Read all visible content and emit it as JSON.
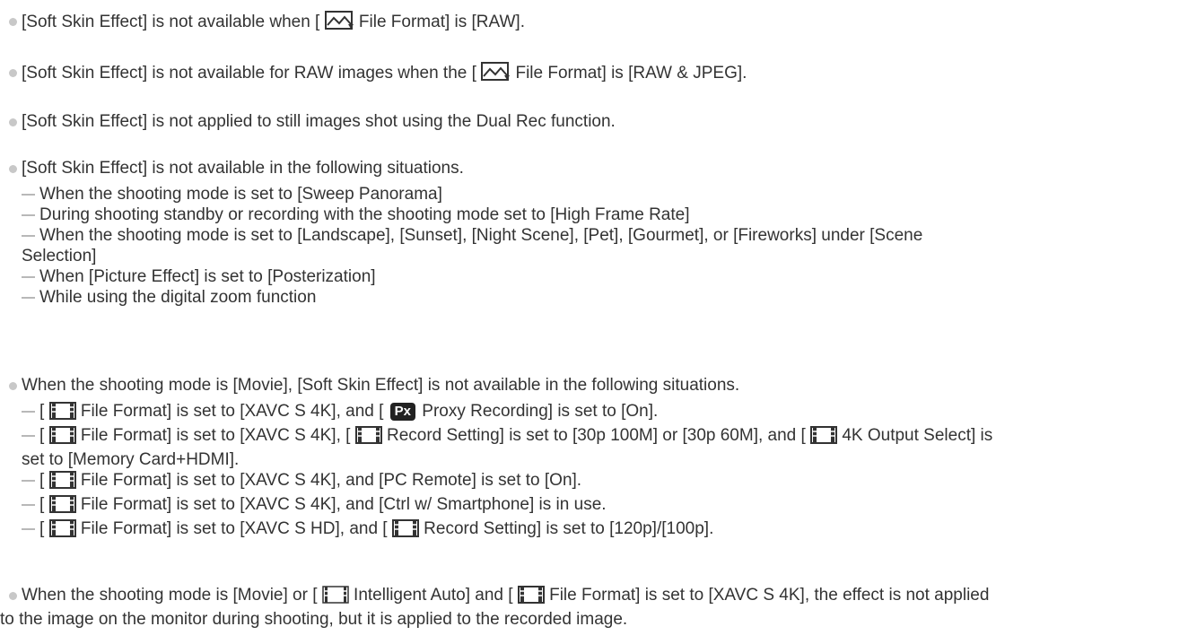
{
  "bullets": {
    "b1": {
      "pre": "[Soft Skin Effect] is not available when [ ",
      "post": " File Format] is [RAW]."
    },
    "b2": {
      "pre": "[Soft Skin Effect] is not available for RAW images when the [ ",
      "post": " File Format] is [RAW & JPEG]."
    },
    "b3": {
      "text": "[Soft Skin Effect] is not applied to still images shot using the Dual Rec function."
    },
    "b4": {
      "text": "[Soft Skin Effect] is not available in the following situations.",
      "items": [
        "When the shooting mode is set to [Sweep Panorama]",
        "During shooting standby or recording with the shooting mode set to [High Frame Rate]",
        "When the shooting mode is set to [Landscape], [Sunset], [Night Scene], [Pet], [Gourmet], or [Fireworks] under [Scene",
        "Selection]",
        "When [Picture Effect] is set to [Posterization]",
        "While using the digital zoom function"
      ]
    },
    "b5": {
      "text": "When the shooting mode is [Movie], [Soft Skin Effect] is not available in the following situations.",
      "px_label": "Px",
      "i1": {
        "a": "[ ",
        "b": " File Format] is set to [XAVC S 4K], and [ ",
        "c": " Proxy Recording] is set to [On]."
      },
      "i2": {
        "a": "[ ",
        "b": " File Format] is set to [XAVC S 4K], [ ",
        "c": " Record Setting] is set to [30p 100M] or [30p 60M], and [ ",
        "d": " 4K Output Select] is",
        "e": "set to [Memory Card+HDMI]."
      },
      "i3": {
        "a": "[ ",
        "b": " File Format] is set to [XAVC S 4K], and [PC Remote] is set to [On]."
      },
      "i4": {
        "a": "[ ",
        "b": " File Format] is set to [XAVC S 4K], and [Ctrl w/ Smartphone] is in use."
      },
      "i5": {
        "a": "[ ",
        "b": " File Format] is set to [XAVC S HD], and [ ",
        "c": " Record Setting] is set to [120p]/[100p]."
      }
    },
    "b6": {
      "a": "When the shooting mode is [Movie] or [ ",
      "b": " Intelligent Auto] and [ ",
      "c": " File Format] is set to [XAVC S 4K], the effect is not applied",
      "d": "to the image on the monitor during shooting, but it is applied to the recorded image."
    }
  },
  "icons": {
    "still": "still-image-icon",
    "movie": "movie-icon",
    "proxy": "proxy-badge"
  }
}
